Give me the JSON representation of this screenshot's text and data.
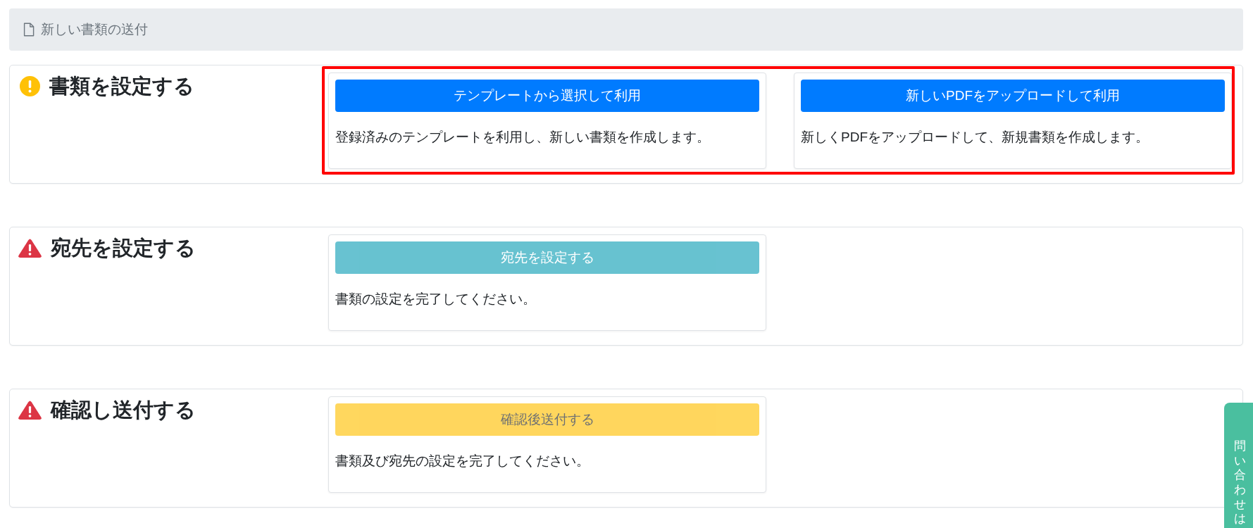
{
  "breadcrumb": {
    "label": "新しい書類の送付"
  },
  "sections": [
    {
      "title": "書類を設定する",
      "kind": "attention",
      "highlighted": true,
      "options": [
        {
          "button": {
            "label": "テンプレートから選択して利用",
            "kind": "primary",
            "disabled": false
          },
          "description": "登録済みのテンプレートを利用し、新しい書類を作成します。"
        },
        {
          "button": {
            "label": "新しいPDFをアップロードして利用",
            "kind": "primary",
            "disabled": false
          },
          "description": "新しくPDFをアップロードして、新規書類を作成します。"
        }
      ]
    },
    {
      "title": "宛先を設定する",
      "kind": "blocked",
      "highlighted": false,
      "options": [
        {
          "button": {
            "label": "宛先を設定する",
            "kind": "info",
            "disabled": true
          },
          "description": "書類の設定を完了してください。"
        }
      ]
    },
    {
      "title": "確認し送付する",
      "kind": "blocked",
      "highlighted": false,
      "options": [
        {
          "button": {
            "label": "確認後送付する",
            "kind": "warning",
            "disabled": true
          },
          "description": "書類及び宛先の設定を完了してください。"
        }
      ]
    }
  ],
  "side_tab": {
    "label": "問い合わせは"
  }
}
